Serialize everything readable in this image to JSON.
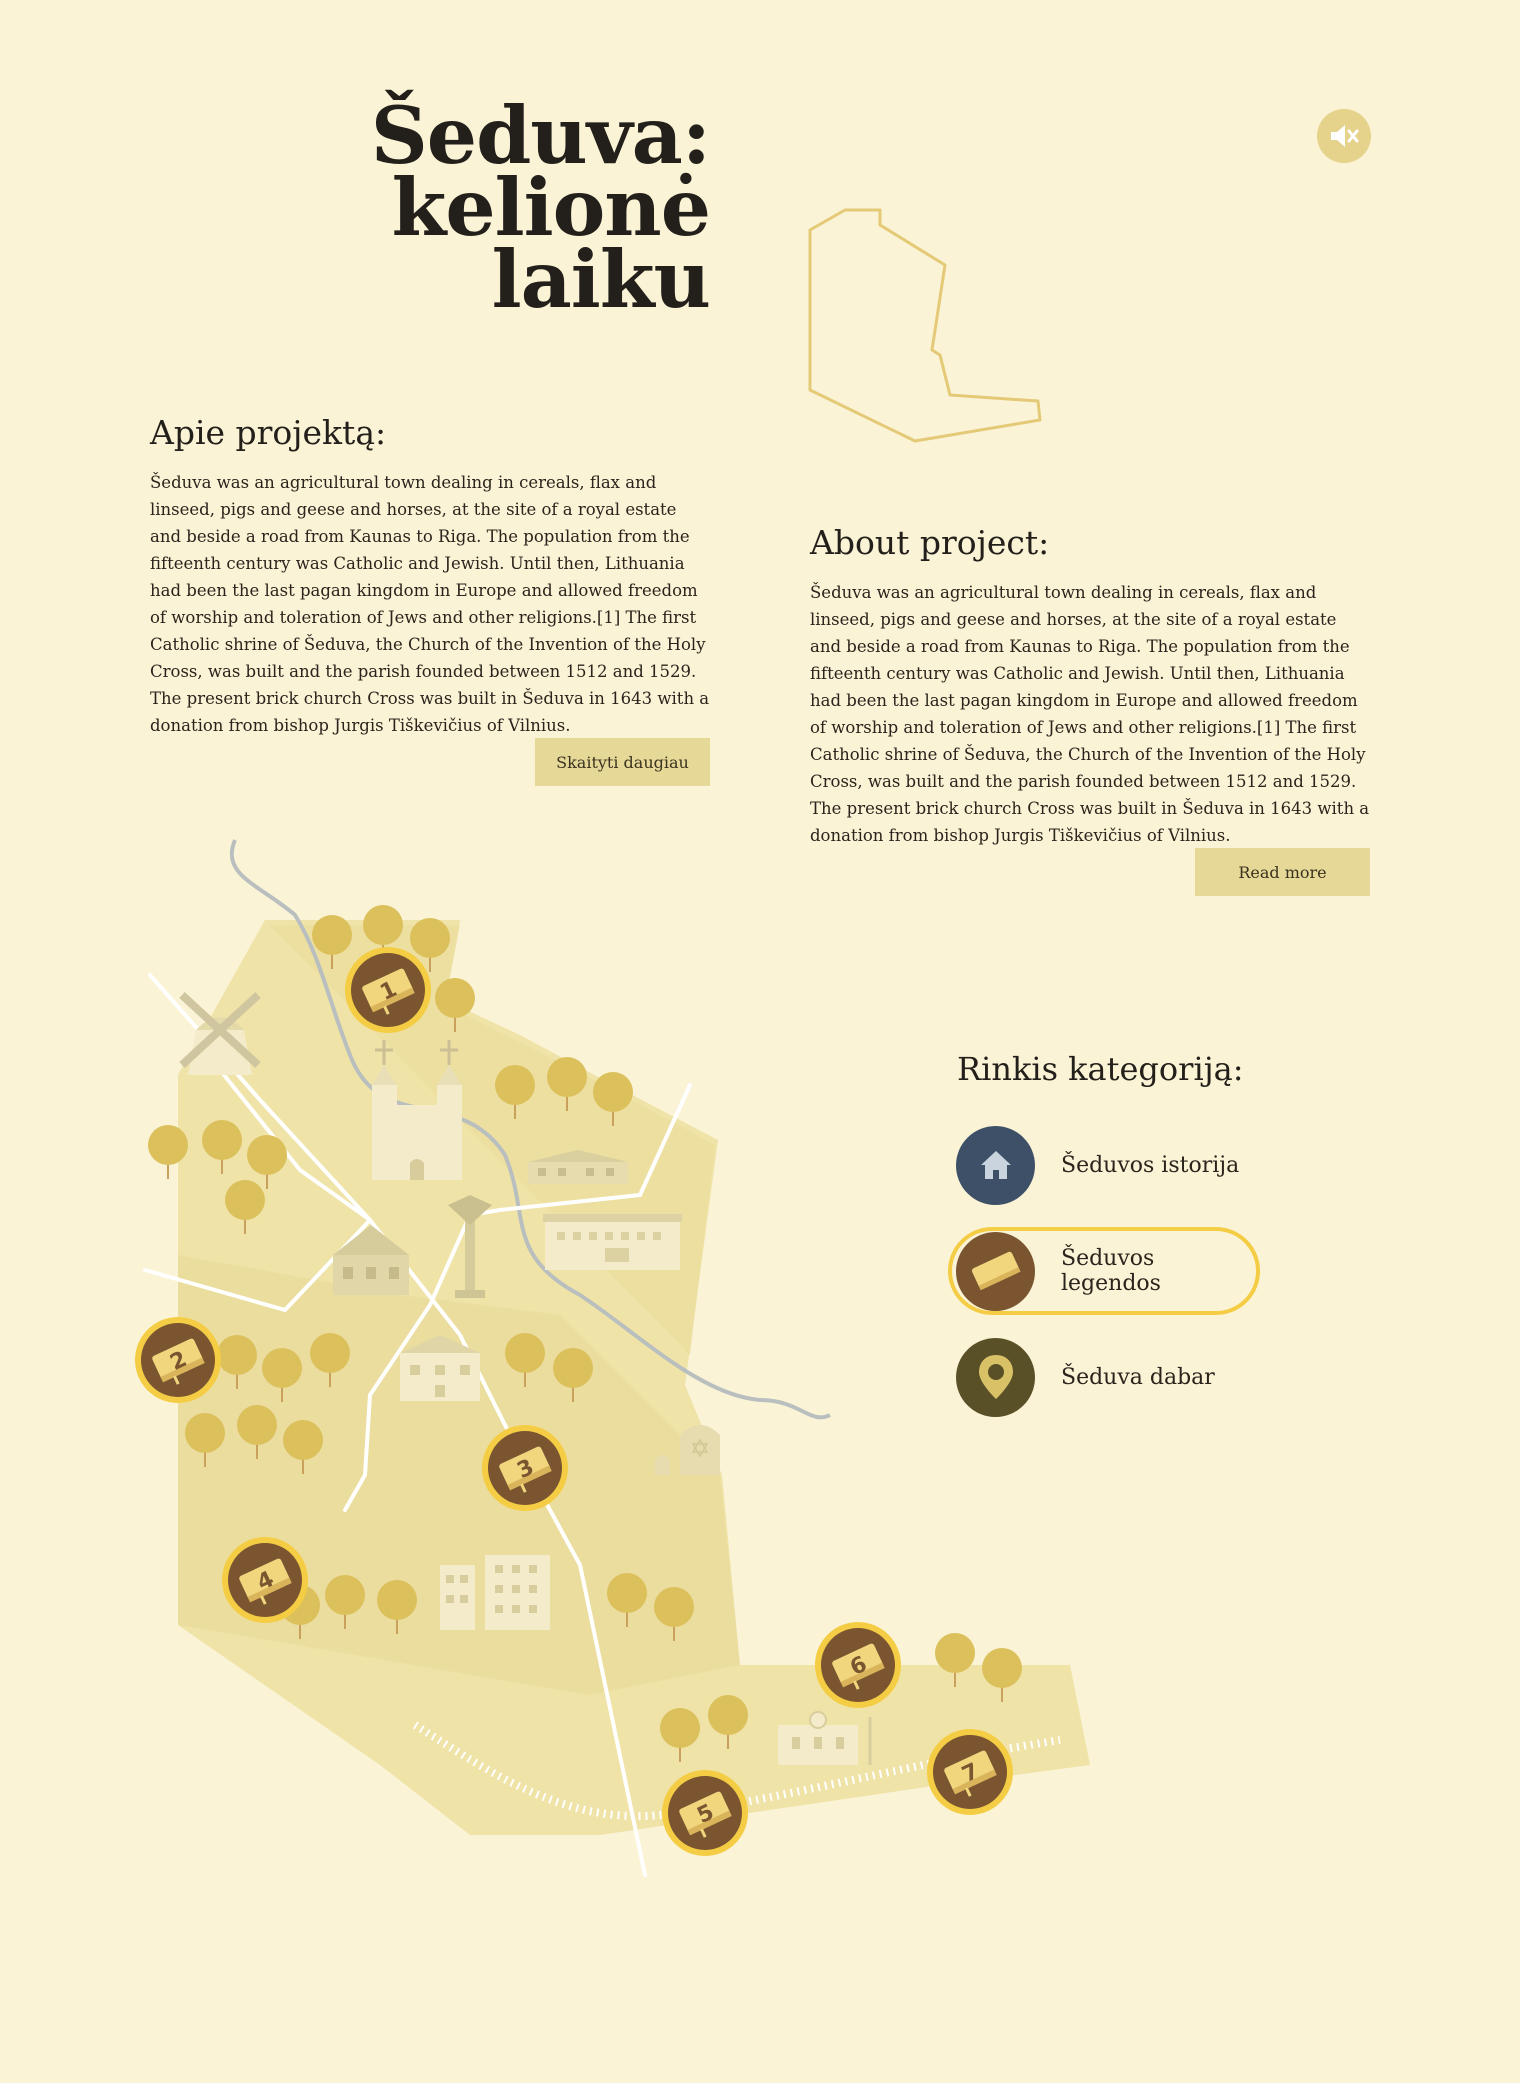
{
  "header": {
    "title_lines": [
      "Šeduva:",
      "kelionė",
      "laiku"
    ],
    "mute_icon": "speaker-mute-icon"
  },
  "about_lt": {
    "heading": "Apie projektą:",
    "text": "Šeduva was an agricultural town dealing in cereals, flax and linseed, pigs and geese and horses, at the site of a royal estate and beside a road from Kaunas to Riga. The population from the fifteenth century was Catholic and Jewish. Until then, Lithuania had been the last pagan kingdom in Europe and allowed freedom of worship and toleration of Jews and other religions.[1] The first Catholic shrine of Šeduva, the Church of the Invention of the Holy Cross, was built and the parish founded between 1512 and 1529. The present brick church Cross was built in Šeduva in 1643 with a donation from bishop Jurgis Tiškevičius of Vilnius.",
    "button": "Skaityti daugiau"
  },
  "about_en": {
    "heading": "About project:",
    "text": "Šeduva was an agricultural town dealing in cereals, flax and linseed, pigs and geese and horses, at the site of a royal estate and beside a road from Kaunas to Riga. The population from the fifteenth century was Catholic and Jewish. Until then, Lithuania had been the last pagan kingdom in Europe and allowed freedom of worship and toleration of Jews and other religions.[1] The first Catholic shrine of Šeduva, the Church of the Invention of the Holy Cross, was built and the parish founded between 1512 and 1529. The present brick church Cross was built in Šeduva in 1643 with a donation from bishop Jurgis Tiškevičius of Vilnius.",
    "button": "Read more"
  },
  "categories": {
    "heading": "Rinkis kategoriją:",
    "items": [
      {
        "label": "Šeduvos istorija",
        "icon": "house-icon",
        "color": "#3d5068",
        "active": false
      },
      {
        "label": "Šeduvos legendos",
        "icon": "book-icon",
        "color": "#7a5530",
        "active": true
      },
      {
        "label": "Šeduva dabar",
        "icon": "location-pin-icon",
        "color": "#5a5028",
        "active": false
      }
    ]
  },
  "map": {
    "pins": [
      "1",
      "2",
      "3",
      "4",
      "5",
      "6",
      "7"
    ],
    "colors": {
      "pin_fill": "#7a5530",
      "pin_ring": "#f4cd45",
      "book": "#f1d67e",
      "land": "#efe3a8"
    }
  }
}
